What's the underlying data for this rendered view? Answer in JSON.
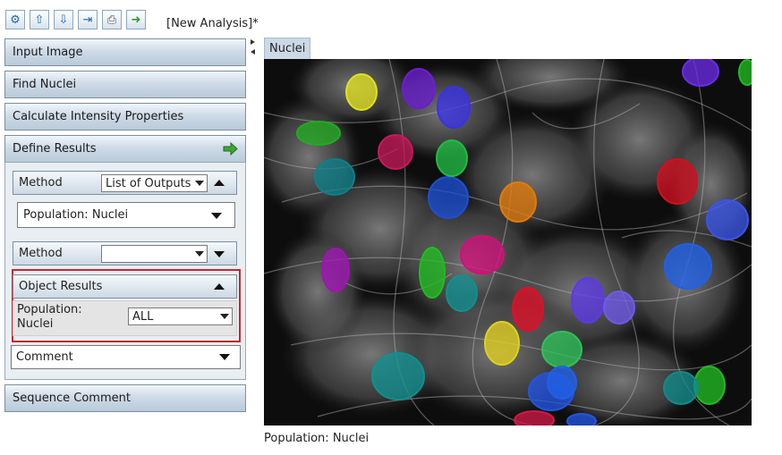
{
  "toolbar": {
    "title": "[New Analysis]*",
    "buttons": [
      {
        "name": "new-analysis-button",
        "icon": "gear-box-icon",
        "glyph": "⚙"
      },
      {
        "name": "load-analysis-button",
        "icon": "upload-icon",
        "glyph": "⇧"
      },
      {
        "name": "save-analysis-button",
        "icon": "download-icon",
        "glyph": "⇩"
      },
      {
        "name": "export-button",
        "icon": "export-icon",
        "glyph": "⇥"
      },
      {
        "name": "print-button",
        "icon": "printer-icon",
        "glyph": "⎙"
      },
      {
        "name": "run-button",
        "icon": "arrow-right-icon",
        "glyph": "➜"
      }
    ]
  },
  "sequence": {
    "input_image": "Input Image",
    "find_nuclei": "Find Nuclei",
    "calc_intensity": "Calculate Intensity Properties",
    "define_results": "Define Results",
    "sequence_comment": "Sequence Comment"
  },
  "define_results": {
    "method1": {
      "label": "Method",
      "value": "List of Outputs"
    },
    "population": {
      "text": "Population: Nuclei"
    },
    "method2": {
      "label": "Method",
      "value": ""
    },
    "object_results": {
      "title": "Object Results",
      "population_label_line1": "Population:",
      "population_label_line2": "Nuclei",
      "population_value": "ALL"
    },
    "comment": {
      "label": "Comment"
    }
  },
  "viewer": {
    "tab": "Nuclei",
    "caption": "Population: Nuclei"
  },
  "colors": {
    "accent_red": "#c8262c",
    "header_blue": "#cfdbe7",
    "go_green": "#3fa534"
  },
  "nuclei": [
    {
      "c": "#e0e020"
    },
    {
      "c": "#6a1fd0"
    },
    {
      "c": "#3a32e6"
    },
    {
      "c": "#22aa22"
    },
    {
      "c": "#c71a5a"
    },
    {
      "c": "#0f7f88"
    },
    {
      "c": "#1e4fd2"
    },
    {
      "c": "#e07a0c"
    },
    {
      "c": "#22bb44"
    },
    {
      "c": "#d01020"
    },
    {
      "c": "#3a55e6"
    },
    {
      "c": "#d0107a"
    },
    {
      "c": "#22bb22"
    },
    {
      "c": "#a014b4"
    },
    {
      "c": "#128f8f"
    },
    {
      "c": "#e01028"
    },
    {
      "c": "#5c3ae6"
    },
    {
      "c": "#2060e8"
    },
    {
      "c": "#e0d020"
    },
    {
      "c": "#30c05a"
    },
    {
      "c": "#6e5ae6"
    },
    {
      "c": "#2255e0"
    },
    {
      "c": "#128f8f"
    },
    {
      "c": "#22bb22"
    },
    {
      "c": "#138a8a"
    },
    {
      "c": "#d01848"
    },
    {
      "c": "#6a2ce6"
    }
  ]
}
